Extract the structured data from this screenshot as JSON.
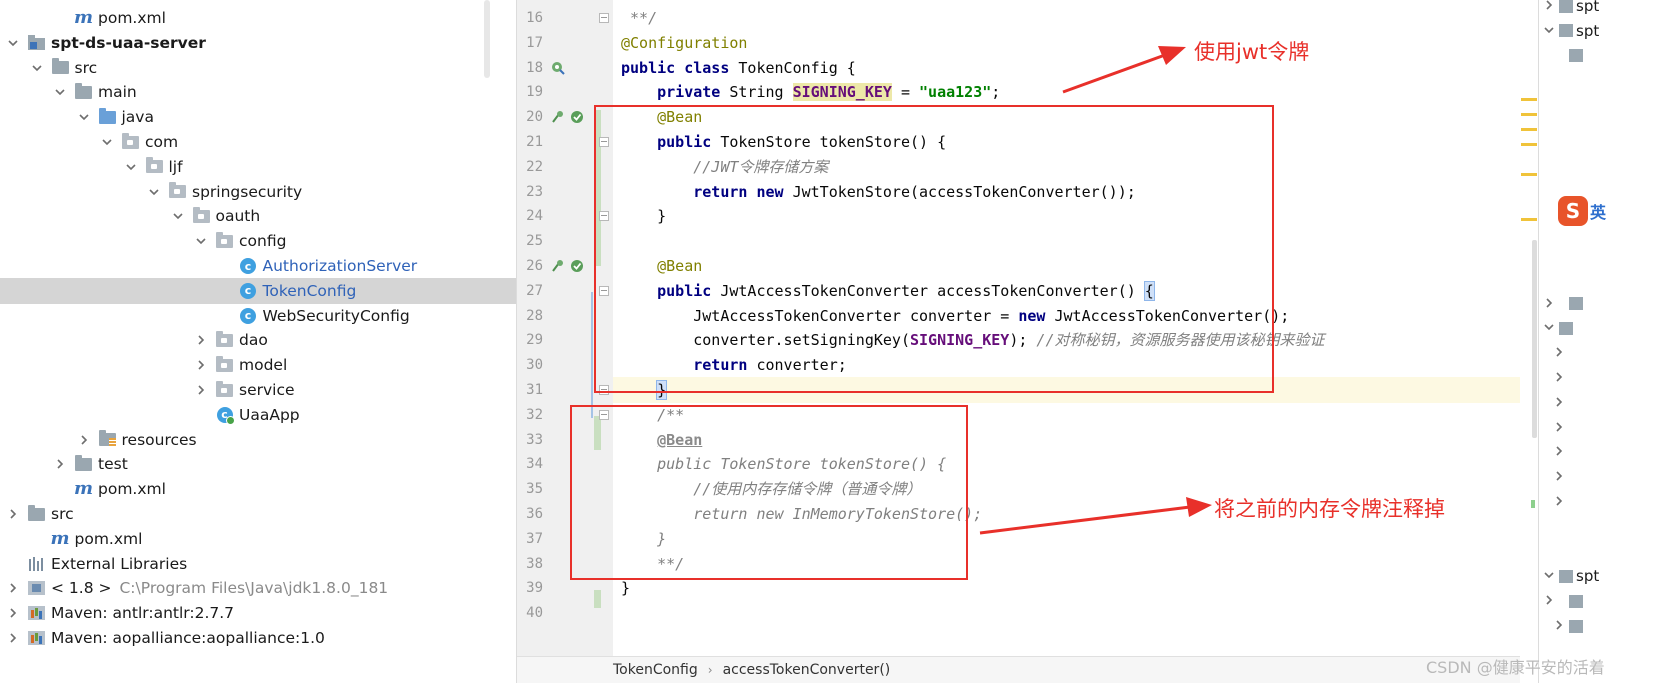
{
  "tree": {
    "rows": [
      {
        "label": "pom.xml",
        "indent": 2,
        "arrow": "none",
        "icon": "maven-m-icon"
      },
      {
        "label": "spt-ds-uaa-server",
        "indent": 0,
        "arrow": "open",
        "icon": "module-folder-icon",
        "bold": true
      },
      {
        "label": "src",
        "indent": 1,
        "arrow": "open",
        "icon": "folder-icon"
      },
      {
        "label": "main",
        "indent": 2,
        "arrow": "open",
        "icon": "folder-icon"
      },
      {
        "label": "java",
        "indent": 3,
        "arrow": "open",
        "icon": "source-folder-icon"
      },
      {
        "label": "com",
        "indent": 4,
        "arrow": "open",
        "icon": "package-icon"
      },
      {
        "label": "ljf",
        "indent": 5,
        "arrow": "open",
        "icon": "package-icon"
      },
      {
        "label": "springsecurity",
        "indent": 6,
        "arrow": "open",
        "icon": "package-icon"
      },
      {
        "label": "oauth",
        "indent": 7,
        "arrow": "open",
        "icon": "package-icon"
      },
      {
        "label": "config",
        "indent": 8,
        "arrow": "open",
        "icon": "package-icon"
      },
      {
        "label": "AuthorizationServer",
        "indent": 9,
        "arrow": "none",
        "icon": "class-icon",
        "blue": true
      },
      {
        "label": "TokenConfig",
        "indent": 9,
        "arrow": "none",
        "icon": "class-icon",
        "blue": true,
        "selected": true
      },
      {
        "label": "WebSecurityConfig",
        "indent": 9,
        "arrow": "none",
        "icon": "class-icon"
      },
      {
        "label": "dao",
        "indent": 8,
        "arrow": "closed",
        "icon": "package-icon"
      },
      {
        "label": "model",
        "indent": 8,
        "arrow": "closed",
        "icon": "package-icon"
      },
      {
        "label": "service",
        "indent": 8,
        "arrow": "closed",
        "icon": "package-icon"
      },
      {
        "label": "UaaApp",
        "indent": 8,
        "arrow": "none",
        "icon": "run-class-icon"
      },
      {
        "label": "resources",
        "indent": 3,
        "arrow": "closed",
        "icon": "resources-folder-icon"
      },
      {
        "label": "test",
        "indent": 2,
        "arrow": "closed",
        "icon": "folder-icon"
      },
      {
        "label": "pom.xml",
        "indent": 2,
        "arrow": "none",
        "icon": "maven-m-icon"
      },
      {
        "label": "src",
        "indent": 0,
        "arrow": "closed",
        "icon": "folder-icon"
      },
      {
        "label": "pom.xml",
        "indent": 1,
        "arrow": "none",
        "icon": "maven-m-icon"
      },
      {
        "label": "External Libraries",
        "indent": 0,
        "arrow": "none",
        "icon": "libraries-icon"
      },
      {
        "label": "< 1.8 >",
        "indent": 0,
        "arrow": "closed",
        "icon": "jdk-icon",
        "extra": "C:\\Program Files\\Java\\jdk1.8.0_181"
      },
      {
        "label": "Maven: antlr:antlr:2.7.7",
        "indent": 0,
        "arrow": "closed",
        "icon": "maven-lib-icon"
      },
      {
        "label": "Maven: aopalliance:aopalliance:1.0",
        "indent": 0,
        "arrow": "closed",
        "icon": "maven-lib-icon"
      }
    ]
  },
  "editor": {
    "first_line": 16,
    "current_line": 31,
    "lines": [
      [
        {
          "t": " **/",
          "c": "cmt"
        }
      ],
      [
        {
          "t": "@Configuration",
          "c": "ann"
        }
      ],
      [
        {
          "t": "public class ",
          "c": "kw"
        },
        {
          "t": "TokenConfig {",
          "c": ""
        }
      ],
      [
        {
          "t": "    ",
          "c": ""
        },
        {
          "t": "private ",
          "c": "kw"
        },
        {
          "t": "String ",
          "c": ""
        },
        {
          "t": "SIGNING_KEY",
          "c": "const hl"
        },
        {
          "t": " = ",
          "c": ""
        },
        {
          "t": "\"uaa123\"",
          "c": "str"
        },
        {
          "t": ";",
          "c": ""
        }
      ],
      [
        {
          "t": "    ",
          "c": ""
        },
        {
          "t": "@Bean",
          "c": "ann"
        }
      ],
      [
        {
          "t": "    ",
          "c": ""
        },
        {
          "t": "public ",
          "c": "kw"
        },
        {
          "t": "TokenStore tokenStore() {",
          "c": ""
        }
      ],
      [
        {
          "t": "        ",
          "c": ""
        },
        {
          "t": "//JWT令牌存储方案",
          "c": "cmt"
        }
      ],
      [
        {
          "t": "        ",
          "c": ""
        },
        {
          "t": "return new ",
          "c": "kw"
        },
        {
          "t": "JwtTokenStore(accessTokenConverter());",
          "c": ""
        }
      ],
      [
        {
          "t": "    }",
          "c": ""
        }
      ],
      [
        {
          "t": "",
          "c": ""
        }
      ],
      [
        {
          "t": "    ",
          "c": ""
        },
        {
          "t": "@Bean",
          "c": "ann"
        }
      ],
      [
        {
          "t": "    ",
          "c": ""
        },
        {
          "t": "public ",
          "c": "kw"
        },
        {
          "t": "JwtAccessTokenConverter accessTokenConverter() ",
          "c": ""
        },
        {
          "t": "{",
          "c": "brace"
        }
      ],
      [
        {
          "t": "        JwtAccessTokenConverter converter = ",
          "c": ""
        },
        {
          "t": "new ",
          "c": "kw"
        },
        {
          "t": "JwtAccessTokenConverter();",
          "c": ""
        }
      ],
      [
        {
          "t": "        converter.setSigningKey(",
          "c": ""
        },
        {
          "t": "SIGNING_KEY",
          "c": "const"
        },
        {
          "t": "); ",
          "c": ""
        },
        {
          "t": "//对称秘钥，资源服务器使用该秘钥来验证",
          "c": "cmt"
        }
      ],
      [
        {
          "t": "        ",
          "c": ""
        },
        {
          "t": "return ",
          "c": "kw"
        },
        {
          "t": "converter;",
          "c": ""
        }
      ],
      [
        {
          "t": "    ",
          "c": ""
        },
        {
          "t": "}",
          "c": "brace"
        }
      ],
      [
        {
          "t": "    ",
          "c": ""
        },
        {
          "t": "/**",
          "c": "cmt"
        }
      ],
      [
        {
          "t": "    ",
          "c": ""
        },
        {
          "t": "@Bean",
          "c": "ann u"
        }
      ],
      [
        {
          "t": "    ",
          "c": ""
        },
        {
          "t": "public TokenStore tokenStore() {",
          "c": "cmt"
        }
      ],
      [
        {
          "t": "        ",
          "c": ""
        },
        {
          "t": "//使用内存存储令牌（普通令牌）",
          "c": "cmt"
        }
      ],
      [
        {
          "t": "        ",
          "c": ""
        },
        {
          "t": "return new InMemoryTokenStore();",
          "c": "cmt"
        }
      ],
      [
        {
          "t": "    ",
          "c": ""
        },
        {
          "t": "}",
          "c": "cmt"
        }
      ],
      [
        {
          "t": "    ",
          "c": ""
        },
        {
          "t": "**/",
          "c": "cmt"
        }
      ],
      [
        {
          "t": "}",
          "c": ""
        }
      ],
      [
        {
          "t": "",
          "c": ""
        }
      ]
    ],
    "gutter_icons": {
      "18": [
        "bean-class-icon"
      ],
      "20": [
        "bean-link-icon",
        "bean-check-icon"
      ],
      "26": [
        "bean-link-icon",
        "bean-check-icon"
      ]
    },
    "folds": [
      16,
      21,
      24,
      27,
      31,
      32
    ]
  },
  "breadcrumb": [
    "TokenConfig",
    "accessTokenConverter()"
  ],
  "right_panel": {
    "rows": [
      "spt",
      "spt",
      "",
      "",
      "",
      "",
      "",
      "",
      "",
      "",
      "",
      "",
      "",
      "",
      "",
      "",
      "",
      "",
      "",
      "",
      "",
      "",
      "",
      "spt",
      "",
      ""
    ],
    "ime_logo": "S",
    "ime_text": "英"
  },
  "annotations": {
    "note1": "使用jwt令牌",
    "note2": "将之前的内存令牌注释掉"
  },
  "watermark": "CSDN @健康平安的活着",
  "colors": {
    "annotation_red": "#e8302a",
    "keyword": "#000080",
    "annotation": "#808000",
    "string": "#008000",
    "comment": "#808080",
    "constant": "#660e7a"
  }
}
